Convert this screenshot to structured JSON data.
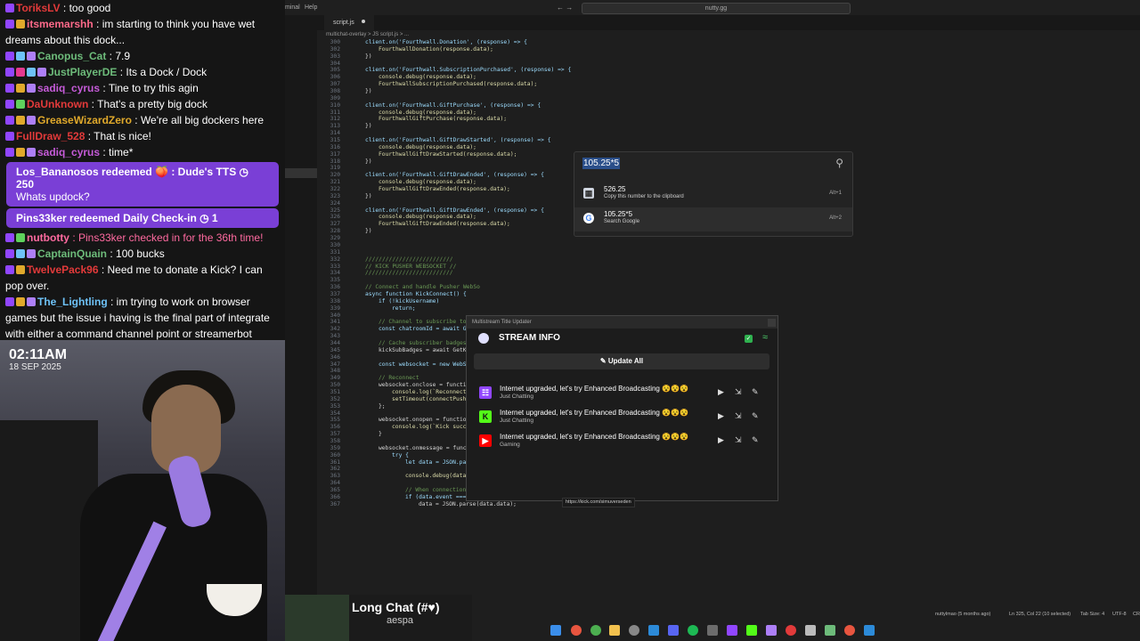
{
  "chat": {
    "messages": [
      {
        "user": "ToriksLV",
        "color": "#e23a3a",
        "badges": [
          "tw"
        ],
        "text": " : too good"
      },
      {
        "user": "itsmemarshh",
        "color": "#ff6a8a",
        "badges": [
          "tw",
          "crown"
        ],
        "text": " : im starting to think you have wet dreams about this dock..."
      },
      {
        "user": "Canopus_Cat",
        "color": "#6dbb7a",
        "badges": [
          "tw",
          "shield",
          "box"
        ],
        "text": " : 7.9"
      },
      {
        "user": "JustPlayerDE",
        "color": "#6dbb7a",
        "badges": [
          "tw",
          "heart",
          "shield",
          "box"
        ],
        "text": " : Its a Dock / Dock"
      },
      {
        "user": "sadiq_cyrus",
        "color": "#c55bd8",
        "badges": [
          "tw",
          "crown",
          "box"
        ],
        "text": " : Tine to try this agin"
      },
      {
        "user": "DaUnknown",
        "color": "#e23a3a",
        "badges": [
          "tw",
          "star"
        ],
        "text": " : That's a pretty big dock"
      },
      {
        "user": "GreaseWizardZero",
        "color": "#e0a92b",
        "badges": [
          "tw",
          "crown",
          "box"
        ],
        "text": " : We're all big dockers here"
      },
      {
        "user": "FullDraw_528",
        "color": "#e23a3a",
        "badges": [
          "tw"
        ],
        "text": " : That is nice!"
      },
      {
        "user": "sadiq_cyrus",
        "color": "#c55bd8",
        "badges": [
          "tw",
          "crown",
          "box"
        ],
        "text": " : time*"
      }
    ],
    "redeem1": {
      "user": "Los_Bananosos",
      "action": " redeemed ",
      "reward": "🍑 : Dude's TTS ◷ 250",
      "message": "Whats updock?"
    },
    "redeem2": {
      "user": "Pins33ker",
      "action": " redeemed ",
      "reward": "Daily Check-in ◷ 1"
    },
    "messages2": [
      {
        "user": "nutbotty",
        "color": "#ff6aa0",
        "badges": [
          "tw",
          "star"
        ],
        "text": " : Pins33ker checked in for the 36th time!",
        "textColor": "#ff6aa0"
      },
      {
        "user": "CaptainQuain",
        "color": "#6dbb7a",
        "badges": [
          "tw",
          "shield",
          "box"
        ],
        "text": " : 100 bucks"
      },
      {
        "user": "TwelvePack96",
        "color": "#e23a3a",
        "badges": [
          "tw",
          "crown"
        ],
        "text": " : Need me to donate a Kick? I can pop over."
      },
      {
        "user": "The_Lightling",
        "color": "#6ec2f7",
        "badges": [
          "tw",
          "crown",
          "box"
        ],
        "text": " : im trying to work on browser games but the issue i having is the final part of integrate with either a command channel point or streamerbot"
      }
    ]
  },
  "cam": {
    "clock": "02:11AM",
    "date": "18 SEP 2025"
  },
  "editor": {
    "menu_terminal": "minal",
    "menu_help": "Help",
    "nav_arrows": "←  →",
    "search_text": "nutty.gg",
    "tab_name": "script.js",
    "breadcrumb": "multichat-overlay  >  JS  script.js  >  ...",
    "lines": [
      {
        "n": "300",
        "i": 1,
        "t": "client.on('Fourthwall.Donation', (response) => {"
      },
      {
        "n": "302",
        "i": 2,
        "t": "FourthwallDonation(response.data);"
      },
      {
        "n": "303",
        "i": 1,
        "t": "})"
      },
      {
        "n": "304",
        "i": 0,
        "t": ""
      },
      {
        "n": "305",
        "i": 1,
        "t": "client.on('Fourthwall.SubscriptionPurchased', (response) => {"
      },
      {
        "n": "306",
        "i": 2,
        "t": "console.debug(response.data);"
      },
      {
        "n": "307",
        "i": 2,
        "t": "FourthwallSubscriptionPurchased(response.data);"
      },
      {
        "n": "308",
        "i": 1,
        "t": "})"
      },
      {
        "n": "309",
        "i": 0,
        "t": ""
      },
      {
        "n": "310",
        "i": 1,
        "t": "client.on('Fourthwall.GiftPurchase', (response) => {"
      },
      {
        "n": "311",
        "i": 2,
        "t": "console.debug(response.data);"
      },
      {
        "n": "312",
        "i": 2,
        "t": "FourthwallGiftPurchase(response.data);"
      },
      {
        "n": "313",
        "i": 1,
        "t": "})"
      },
      {
        "n": "314",
        "i": 0,
        "t": ""
      },
      {
        "n": "315",
        "i": 1,
        "t": "client.on('Fourthwall.GiftDrawStarted', (response) => {"
      },
      {
        "n": "316",
        "i": 2,
        "t": "console.debug(response.data);"
      },
      {
        "n": "317",
        "i": 2,
        "t": "FourthwallGiftDrawStarted(response.data);"
      },
      {
        "n": "318",
        "i": 1,
        "t": "})"
      },
      {
        "n": "319",
        "i": 0,
        "t": ""
      },
      {
        "n": "320",
        "i": 1,
        "t": "client.on('Fourthwall.GiftDrawEnded', (response) => {"
      },
      {
        "n": "321",
        "i": 2,
        "t": "console.debug(response.data);"
      },
      {
        "n": "322",
        "i": 2,
        "t": "FourthwallGiftDrawEnded(response.data);"
      },
      {
        "n": "323",
        "i": 1,
        "t": "})"
      },
      {
        "n": "324",
        "i": 0,
        "t": ""
      },
      {
        "n": "325",
        "i": 1,
        "t": "client.on('Fourthwall.GiftDrawEnded', (response) => {"
      },
      {
        "n": "326",
        "i": 2,
        "t": "console.debug(response.data);"
      },
      {
        "n": "327",
        "i": 2,
        "t": "FourthwallGiftDrawEnded(response.data);"
      },
      {
        "n": "328",
        "i": 1,
        "t": "})"
      },
      {
        "n": "329",
        "i": 0,
        "t": ""
      },
      {
        "n": "330",
        "i": 0,
        "t": ""
      },
      {
        "n": "331",
        "i": 0,
        "t": ""
      },
      {
        "n": "332",
        "i": 1,
        "t": "//////////////////////////"
      },
      {
        "n": "333",
        "i": 1,
        "t": "// KICK PUSHER WEBSOCKET //"
      },
      {
        "n": "334",
        "i": 1,
        "t": "//////////////////////////"
      },
      {
        "n": "335",
        "i": 0,
        "t": ""
      },
      {
        "n": "336",
        "i": 1,
        "t": "// Connect and handle Pusher WebSo"
      },
      {
        "n": "337",
        "i": 1,
        "t": "async function KickConnect() {"
      },
      {
        "n": "338",
        "i": 2,
        "t": "if (!kickUsername)"
      },
      {
        "n": "339",
        "i": 3,
        "t": "return;"
      },
      {
        "n": "340",
        "i": 0,
        "t": ""
      },
      {
        "n": "341",
        "i": 2,
        "t": "// Channel to subscribe to (y"
      },
      {
        "n": "342",
        "i": 2,
        "t": "const chatroomId = await GetK"
      },
      {
        "n": "343",
        "i": 0,
        "t": ""
      },
      {
        "n": "344",
        "i": 2,
        "t": "// Cache subscriber badges"
      },
      {
        "n": "345",
        "i": 2,
        "t": "kickSubBadges = await GetKick"
      },
      {
        "n": "346",
        "i": 0,
        "t": ""
      },
      {
        "n": "347",
        "i": 2,
        "t": "const websocket = new WebSock"
      },
      {
        "n": "348",
        "i": 0,
        "t": ""
      },
      {
        "n": "349",
        "i": 2,
        "t": "// Reconnect"
      },
      {
        "n": "350",
        "i": 2,
        "t": "websocket.onclose = function"
      },
      {
        "n": "351",
        "i": 3,
        "t": "console.log(`Reconnecting"
      },
      {
        "n": "352",
        "i": 3,
        "t": "setTimeout(connectPusher,"
      },
      {
        "n": "353",
        "i": 2,
        "t": "};"
      },
      {
        "n": "354",
        "i": 0,
        "t": ""
      },
      {
        "n": "355",
        "i": 2,
        "t": "websocket.onopen = function () {"
      },
      {
        "n": "356",
        "i": 3,
        "t": "console.log(`Kick successfully conntected to ${kickUsername}.`);"
      },
      {
        "n": "357",
        "i": 2,
        "t": "}"
      },
      {
        "n": "358",
        "i": 0,
        "t": ""
      },
      {
        "n": "359",
        "i": 2,
        "t": "websocket.onmessage = function (response) {"
      },
      {
        "n": "360",
        "i": 3,
        "t": "try {"
      },
      {
        "n": "361",
        "i": 4,
        "t": "let data = JSON.parse(response.data);"
      },
      {
        "n": "362",
        "i": 0,
        "t": ""
      },
      {
        "n": "363",
        "i": 4,
        "t": "console.debug(data);"
      },
      {
        "n": "364",
        "i": 0,
        "t": ""
      },
      {
        "n": "365",
        "i": 4,
        "t": "// When connection is established, subscribe to a channel"
      },
      {
        "n": "366",
        "i": 4,
        "t": "if (data.event === 'pusher:connection_established') {"
      },
      {
        "n": "367",
        "i": 5,
        "t": "data = JSON.parse(data.data);"
      }
    ]
  },
  "calc": {
    "query": "105.25*5",
    "result": "526.25",
    "result_sub": "Copy this number to the clipboard",
    "result_key": "Alt+1",
    "search": "105.25*5",
    "search_sub": "Search Google",
    "search_key": "Alt+2"
  },
  "stream_info": {
    "window_title": "Multistream Title Updater",
    "heading": "STREAM INFO",
    "update_all": "Update All",
    "rows": [
      {
        "platform": "twitch",
        "color": "#9146ff",
        "glyph": "☷",
        "title": "Internet upgraded, let's try Enhanced Broadcasting 😵😵😵",
        "category": "Just Chatting"
      },
      {
        "platform": "kick",
        "color": "#53fc18",
        "glyph": "K",
        "title": "Internet upgraded, let's try Enhanced Broadcasting 😵😵😵",
        "category": "Just Chatting"
      },
      {
        "platform": "youtube",
        "color": "#ff0000",
        "glyph": "▶",
        "title": "Internet upgraded, let's try Enhanced Broadcasting 😵😵😵",
        "category": "Gaming"
      }
    ],
    "tooltip": "https://kick.com/simuverseden"
  },
  "now_playing": {
    "title": "Long Chat (#♥)",
    "artist": "aespa"
  },
  "status": {
    "git": "nuttylmao (5 months ago)",
    "pos": "Ln 325, Col 22 (10 selected)",
    "spaces": "Tab Size: 4",
    "enc": "UTF-8",
    "eol": "CR"
  }
}
